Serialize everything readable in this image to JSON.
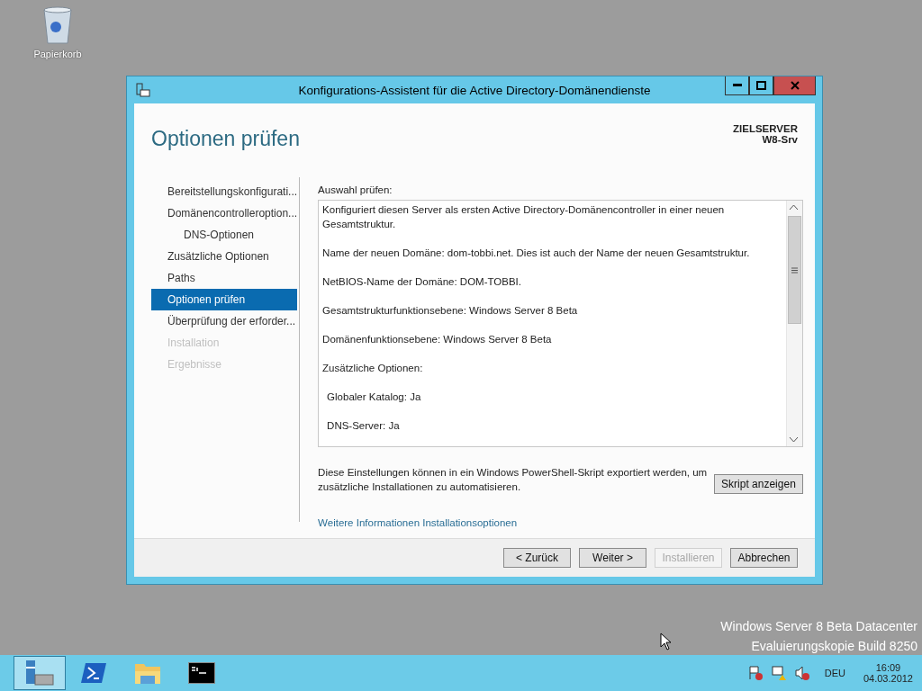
{
  "desktop": {
    "icons": [
      {
        "label": "Papierkorb"
      }
    ],
    "watermark": [
      "Windows Server 8 Beta Datacenter",
      "Evaluierungskopie Build 8250"
    ]
  },
  "window": {
    "title": "Konfigurations-Assistent für die Active Directory-Domänendienste",
    "heading": "Optionen prüfen",
    "target_label": "ZIELSERVER",
    "target_name": "W8-Srv",
    "steps": [
      {
        "label": "Bereitstellungskonfigurati...",
        "selected": false,
        "disabled": false
      },
      {
        "label": "Domänencontrolleroption...",
        "selected": false,
        "disabled": false,
        "children": [
          {
            "label": "DNS-Optionen",
            "selected": false,
            "disabled": false
          }
        ]
      },
      {
        "label": "Zusätzliche Optionen",
        "selected": false,
        "disabled": false
      },
      {
        "label": "Paths",
        "selected": false,
        "disabled": false
      },
      {
        "label": "Optionen prüfen",
        "selected": true,
        "disabled": false
      },
      {
        "label": "Überprüfung der erforder...",
        "selected": false,
        "disabled": false
      },
      {
        "label": "Installation",
        "selected": false,
        "disabled": true
      },
      {
        "label": "Ergebnisse",
        "selected": false,
        "disabled": true
      }
    ],
    "review_label": "Auswahl prüfen:",
    "review_lines": [
      {
        "text": "Konfiguriert diesen Server als ersten Active Directory-Domänencontroller in einer neuen Gesamtstruktur."
      },
      {
        "text": "Name der neuen Domäne: dom-tobbi.net. Dies ist auch der Name der neuen Gesamtstruktur."
      },
      {
        "text": "NetBIOS-Name der Domäne: DOM-TOBBI."
      },
      {
        "text": "Gesamtstrukturfunktionsebene: Windows Server 8 Beta"
      },
      {
        "text": "Domänenfunktionsebene: Windows Server 8 Beta"
      },
      {
        "text": "Zusätzliche Optionen:",
        "children": [
          {
            "text": "Globaler Katalog: Ja"
          },
          {
            "text": "DNS-Server: Ja"
          }
        ]
      }
    ],
    "export_note": "Diese Einstellungen können in ein Windows PowerShell-Skript exportiert werden, um zusätzliche Installationen zu automatisieren.",
    "script_button": "Skript anzeigen",
    "more_info_link": "Weitere Informationen Installationsoptionen",
    "buttons": [
      {
        "label": "< Zurück",
        "disabled": false
      },
      {
        "label": "Weiter >",
        "disabled": false
      },
      {
        "label": "Installieren",
        "disabled": true
      },
      {
        "label": "Abbrechen",
        "disabled": false
      }
    ]
  },
  "taskbar": {
    "items": [
      {
        "kind": "server-manager",
        "selected": true
      },
      {
        "kind": "powershell",
        "selected": false
      },
      {
        "kind": "explorer",
        "selected": false
      },
      {
        "kind": "console",
        "selected": false
      }
    ],
    "language": "DEU",
    "time": "16:09",
    "date": "04.03.2012"
  }
}
